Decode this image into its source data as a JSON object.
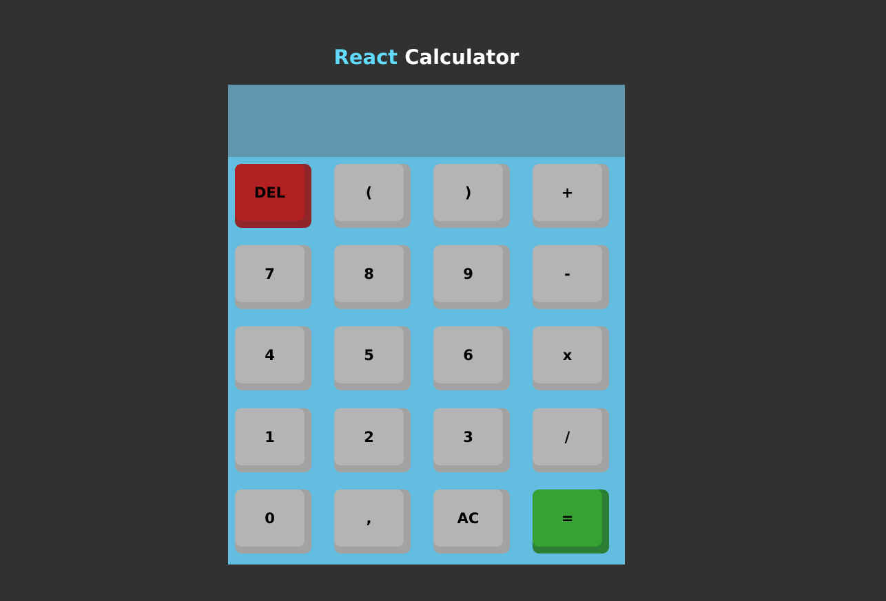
{
  "header": {
    "title_part1": "React",
    "title_part2": "Calculator"
  },
  "display": {
    "value": ""
  },
  "colors": {
    "background": "#313131",
    "brand_react": "#61dafb",
    "calculator_body": "#62bde0",
    "display": "#5f98ad",
    "key": "#b4b4b4",
    "delete_key": "#b12022",
    "equals_key": "#37a233"
  },
  "keys": {
    "delete": "DEL",
    "open_paren": "(",
    "close_paren": ")",
    "plus": "+",
    "seven": "7",
    "eight": "8",
    "nine": "9",
    "minus": "-",
    "four": "4",
    "five": "5",
    "six": "6",
    "multiply": "x",
    "one": "1",
    "two": "2",
    "three": "3",
    "divide": "/",
    "zero": "0",
    "comma": ",",
    "all_clear": "AC",
    "equals": "="
  }
}
